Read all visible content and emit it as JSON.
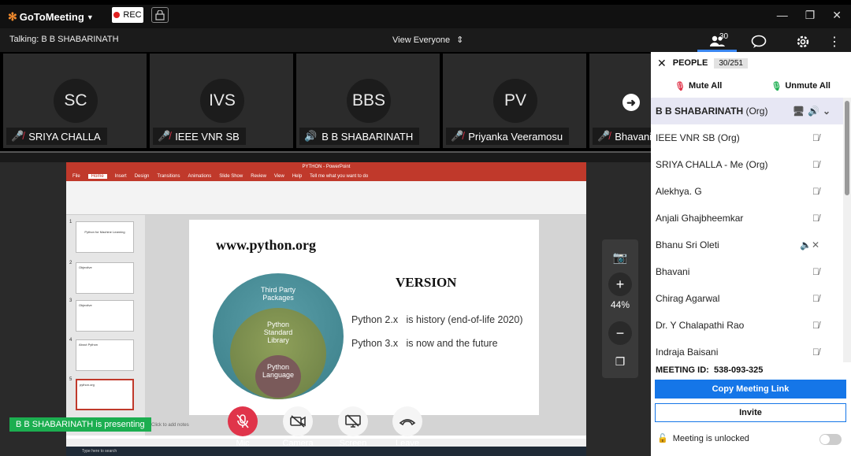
{
  "app": {
    "name": "GoToMeeting",
    "rec_label": "REC"
  },
  "header": {
    "talking": "Talking: B B SHABARINATH",
    "view": "View Everyone",
    "people_count": "30"
  },
  "tiles": [
    {
      "initials": "SC",
      "name": "SRIYA CHALLA",
      "audio": "muted"
    },
    {
      "initials": "IVS",
      "name": "IEEE VNR SB",
      "audio": "muted"
    },
    {
      "initials": "BBS",
      "name": "B B SHABARINATH",
      "audio": "speaking"
    },
    {
      "initials": "PV",
      "name": "Priyanka Veeramosu",
      "audio": "muted"
    },
    {
      "initials": "",
      "name": "Bhavani",
      "audio": "muted"
    }
  ],
  "presentation": {
    "window_title": "PYTHON - PowerPoint",
    "ribbon_tabs": [
      "File",
      "Home",
      "Insert",
      "Design",
      "Transitions",
      "Animations",
      "Slide Show",
      "Review",
      "View",
      "Help",
      "Tell me what you want to do"
    ],
    "slide": {
      "url": "www.python.org",
      "heading": "VERSION",
      "lines": [
        {
          "version": "Python 2.x",
          "note": "is history (end-of-life 2020)"
        },
        {
          "version": "Python 3.x",
          "note": "is now and the future"
        }
      ],
      "circles": [
        "Third Party Packages",
        "Python Standard Library",
        "Python Language"
      ]
    },
    "notes_placeholder": "Click to add notes",
    "thumb_titles": [
      "Python for Machine Learning",
      "Objective",
      "Objective",
      "About Python",
      "python.org"
    ],
    "taskbar_search": "Type here to search"
  },
  "zoom": {
    "level": "44%"
  },
  "presenting_label": "B B SHABARINATH is presenting",
  "controls": [
    "Mic",
    "Camera",
    "Screen",
    "Leave"
  ],
  "panel": {
    "title": "PEOPLE",
    "count": "30/251",
    "mute_all": "Mute All",
    "unmute_all": "Unmute All",
    "people": [
      {
        "name": "B B SHABARINATH",
        "tag": "(Org)",
        "host": true
      },
      {
        "name": "IEEE VNR SB",
        "tag": "(Org)",
        "icon": "mic-muted"
      },
      {
        "name": "SRIYA CHALLA",
        "tag": "- Me (Org)",
        "icon": "mic-muted"
      },
      {
        "name": "Alekhya. G",
        "tag": "",
        "icon": "mic-muted"
      },
      {
        "name": "Anjali Ghajbheemkar",
        "tag": "",
        "icon": "mic-muted"
      },
      {
        "name": "Bhanu Sri Oleti",
        "tag": "",
        "icon": "speaker-muted"
      },
      {
        "name": "Bhavani",
        "tag": "",
        "icon": "mic-muted"
      },
      {
        "name": "Chirag Agarwal",
        "tag": "",
        "icon": "mic-muted"
      },
      {
        "name": "Dr. Y Chalapathi Rao",
        "tag": "",
        "icon": "mic-muted"
      },
      {
        "name": "Indraja Baisani",
        "tag": "",
        "icon": "mic-muted"
      }
    ],
    "meeting_id_label": "MEETING ID:",
    "meeting_id": "538-093-325",
    "copy_link": "Copy Meeting Link",
    "invite": "Invite",
    "lock_status": "Meeting is unlocked"
  },
  "colors": {
    "accent": "#1576e8",
    "muted": "#e0344a",
    "speaking": "#1cae50",
    "brand": "#f68d2e",
    "ppt": "#c0392b"
  }
}
